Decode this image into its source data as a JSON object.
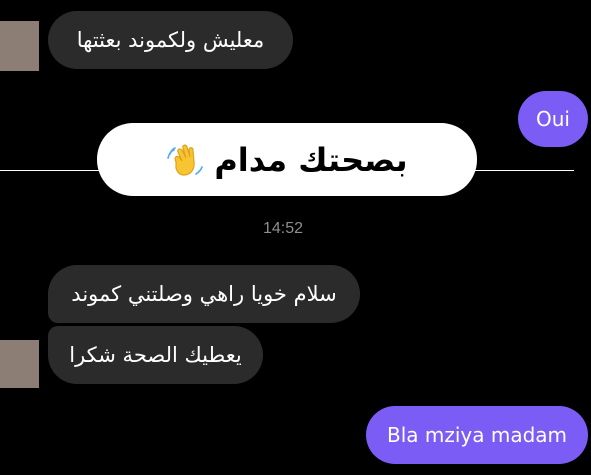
{
  "messages": [
    {
      "id": "in-1",
      "direction": "incoming",
      "text": "معليش ولكموند بعثتها"
    },
    {
      "id": "out-1",
      "direction": "outgoing",
      "text": "Oui"
    },
    {
      "id": "in-2",
      "direction": "incoming",
      "text": "سلام خويا راهي وصلتني كموند"
    },
    {
      "id": "in-3",
      "direction": "incoming",
      "text": "يعطيك الصحة شكرا"
    },
    {
      "id": "out-2",
      "direction": "outgoing",
      "text": "Bla mziya madam"
    }
  ],
  "sticker": {
    "text": "بصحتك مدام",
    "icon": "waving-hand-icon"
  },
  "timestamp": "14:52",
  "colors": {
    "background": "#000000",
    "incoming_bubble": "#2b2b2b",
    "outgoing_bubble": "#7b5cf5",
    "sticker_background": "#ffffff",
    "timestamp_text": "#8e8e93"
  }
}
